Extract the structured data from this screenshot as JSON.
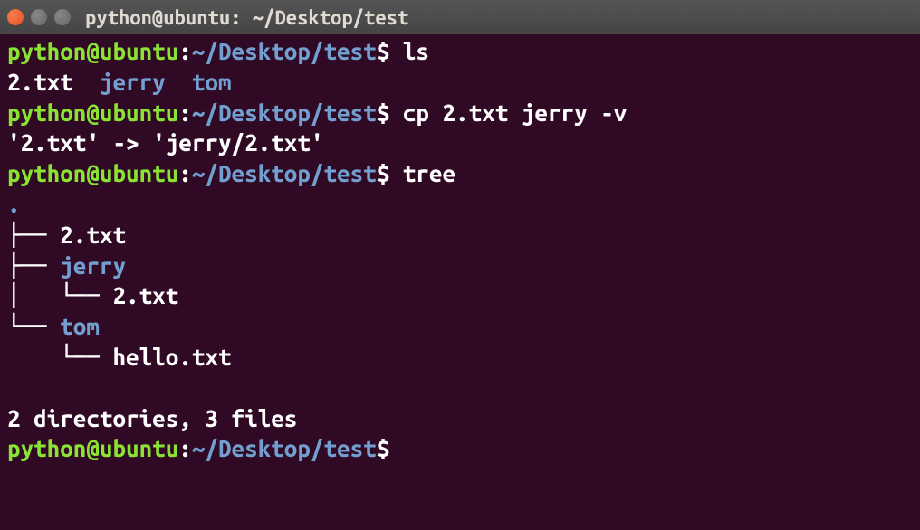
{
  "titlebar": {
    "text": "python@ubuntu: ~/Desktop/test"
  },
  "prompt": {
    "user_host": "python@ubuntu",
    "colon": ":",
    "path": "~/Desktop/test",
    "dollar": "$"
  },
  "lines": {
    "cmd1": " ls",
    "ls_file": "2.txt  ",
    "ls_dir1": "jerry",
    "ls_spacer": "  ",
    "ls_dir2": "tom",
    "cmd2": " cp 2.txt jerry -v",
    "cp_output": "'2.txt' -> 'jerry/2.txt'",
    "cmd3": " tree",
    "tree_dot": ".",
    "tree_1": "├── 2.txt",
    "tree_2_prefix": "├── ",
    "tree_2_name": "jerry",
    "tree_3": "│   └── 2.txt",
    "tree_4_prefix": "└── ",
    "tree_4_name": "tom",
    "tree_5": "    └── hello.txt",
    "tree_blank": " ",
    "tree_summary": "2 directories, 3 files",
    "cmd4": ""
  }
}
